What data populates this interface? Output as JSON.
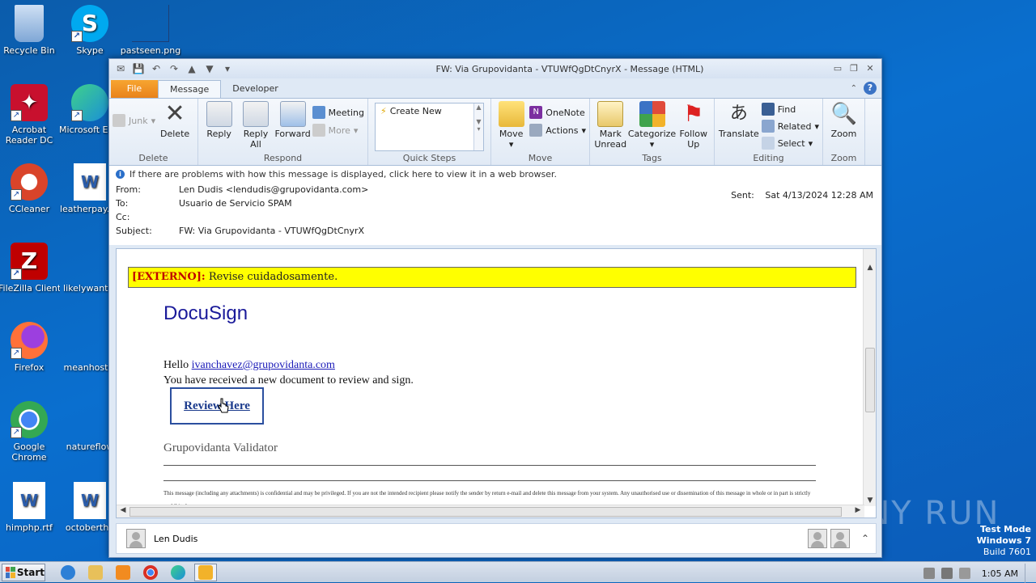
{
  "desktop": {
    "icons": [
      {
        "label": "Recycle Bin",
        "color": "#7fa7d6"
      },
      {
        "label": "Skype",
        "color": "#00a9f0"
      },
      {
        "label": "pastseen.png",
        "color": "#0b5cab"
      },
      {
        "label": "Acrobat Reader DC",
        "color": "#c8102e"
      },
      {
        "label": "Microsoft Edge",
        "color": "#1a8fd8"
      },
      {
        "label": "CCleaner",
        "color": "#d9442a"
      },
      {
        "label": "leatherpay.rtf",
        "color": "#2a5caa"
      },
      {
        "label": "FileZilla Client",
        "color": "#bf0000"
      },
      {
        "label": "likelywant.p",
        "color": "#0b5cab"
      },
      {
        "label": "Firefox",
        "color": "#ff7139"
      },
      {
        "label": "meanhostin",
        "color": "#0b5cab"
      },
      {
        "label": "Google Chrome",
        "color": "#34a853"
      },
      {
        "label": "natureflow",
        "color": "#0b5cab"
      },
      {
        "label": "himphp.rtf",
        "color": "#2a5caa"
      },
      {
        "label": "octoberthe",
        "color": "#2a5caa"
      }
    ]
  },
  "window": {
    "title": "FW: Via Grupovidanta - VTUWfQgDtCnyrX  -  Message (HTML)",
    "tabs": {
      "file": "File",
      "message": "Message",
      "developer": "Developer"
    }
  },
  "ribbon": {
    "delete_group": {
      "label": "Delete",
      "junk": "Junk",
      "delete": "Delete"
    },
    "respond_group": {
      "label": "Respond",
      "reply": "Reply",
      "reply_all": "Reply All",
      "forward": "Forward",
      "meeting": "Meeting",
      "more": "More"
    },
    "quicksteps_group": {
      "label": "Quick Steps",
      "create_new": "Create New"
    },
    "move_group": {
      "label": "Move",
      "move": "Move",
      "onenote": "OneNote",
      "actions": "Actions"
    },
    "tags_group": {
      "label": "Tags",
      "mark_unread": "Mark Unread",
      "categorize": "Categorize",
      "follow_up": "Follow Up"
    },
    "editing_group": {
      "label": "Editing",
      "translate": "Translate",
      "find": "Find",
      "related": "Related",
      "select": "Select"
    },
    "zoom_group": {
      "label": "Zoom",
      "zoom": "Zoom"
    }
  },
  "message": {
    "infobar": "If there are problems with how this message is displayed, click here to view it in a web browser.",
    "from_label": "From:",
    "from": "Len Dudis <lendudis@grupovidanta.com>",
    "to_label": "To:",
    "to": "Usuario de Servicio SPAM",
    "cc_label": "Cc:",
    "cc": "",
    "subject_label": "Subject:",
    "subject": "FW: Via Grupovidanta - VTUWfQgDtCnyrX",
    "sent_label": "Sent:",
    "sent": "Sat 4/13/2024 12:28 AM"
  },
  "body": {
    "banner_tag": "[EXTERNO]:",
    "banner_text": " Revise cuidadosamente.",
    "brand": "DocuSign",
    "hello": "Hello ",
    "email": "ivanchavez@grupovidanta.com",
    "line2": "You have received a new document to review and sign.",
    "review_button": "Review Here",
    "validator": "Grupovidanta Validator",
    "disclaimer": "This message (including any attachments) is confidential and may be privileged. If you are not the intended recipient please notify the sender by return e-mail and delete this message from your system. Any unauthorised use or dissemination of this message in whole or in part is strictly prohibited."
  },
  "people_pane": {
    "name": "Len Dudis"
  },
  "taskbar": {
    "start": "Start",
    "clock": "1:05 AM"
  },
  "watermark": {
    "line1": "Test Mode",
    "line2": "Windows 7",
    "line3": "Build 7601",
    "brand": "ANY RUN"
  }
}
